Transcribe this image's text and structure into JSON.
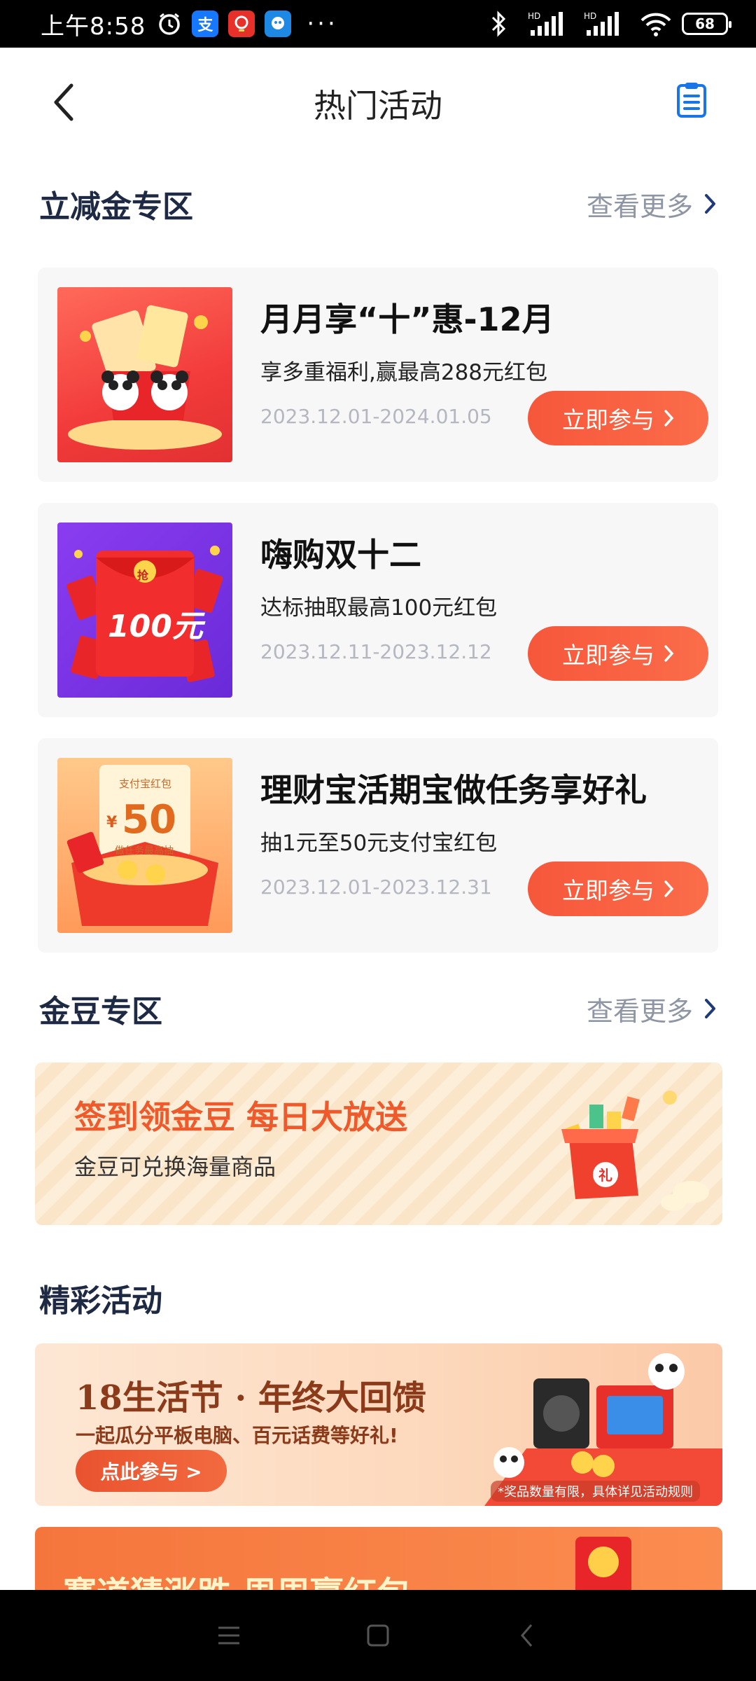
{
  "status_bar": {
    "time": "上午8:58",
    "alipay_icon": "支",
    "dots": "···",
    "battery": "68"
  },
  "nav": {
    "title": "热门活动"
  },
  "section_lijian": {
    "title": "立减金专区",
    "more": "查看更多"
  },
  "cards": [
    {
      "title": "月月享“十”惠-12月",
      "desc": "享多重福利,赢最高288元红包",
      "date": "2023.12.01-2024.01.05",
      "button": "立即参与"
    },
    {
      "title": "嗨购双十二",
      "desc": "达标抽取最高100元红包",
      "date": "2023.12.11-2023.12.12",
      "button": "立即参与",
      "thumb_text": "100元",
      "thumb_badge": "抢"
    },
    {
      "title": "理财宝活期宝做任务享好礼",
      "desc": "抽1元至50元支付宝红包",
      "date": "2023.12.01-2023.12.31",
      "button": "立即参与",
      "thumb_top": "支付宝红包",
      "thumb_amount": "50",
      "thumb_yen": "¥",
      "thumb_caption": "做任务最高抽"
    }
  ],
  "section_jindou": {
    "title": "金豆专区",
    "more": "查看更多"
  },
  "bean_banner": {
    "title": "签到领金豆 每日大放送",
    "subtitle": "金豆可兑换海量商品",
    "gift_char": "礼"
  },
  "section_jingcai": {
    "title": "精彩活动"
  },
  "promo1": {
    "title": "18生活节 · 年终大回馈",
    "subtitle": "一起瓜分平板电脑、百元话费等好礼!",
    "button": "点此参与 >",
    "note": "*奖品数量有限，具体详见活动规则"
  },
  "promo2": {
    "title": "赛道猜涨跌 周周赢红包"
  }
}
